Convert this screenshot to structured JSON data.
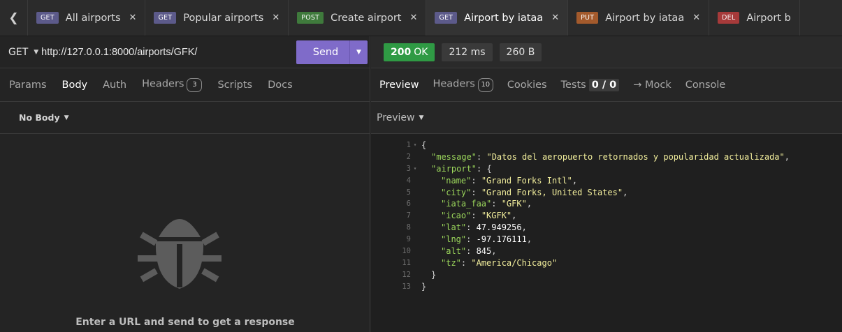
{
  "tabs": [
    {
      "method": "GET",
      "title": "All airports",
      "color": "#5c5a8a",
      "active": false
    },
    {
      "method": "GET",
      "title": "Popular airports",
      "color": "#5c5a8a",
      "active": false
    },
    {
      "method": "POST",
      "title": "Create airport",
      "color": "#3f7a3c",
      "active": false
    },
    {
      "method": "GET",
      "title": "Airport by iataa",
      "color": "#5c5a8a",
      "active": true
    },
    {
      "method": "PUT",
      "title": "Airport by iataa",
      "color": "#a35a2c",
      "active": false
    },
    {
      "method": "DEL",
      "title": "Airport b",
      "color": "#a63a3a",
      "active": false
    }
  ],
  "request": {
    "method": "GET",
    "url": "http://127.0.0.1:8000/airports/GFK/",
    "send_label": "Send",
    "tabs": [
      {
        "label": "Params",
        "active": false
      },
      {
        "label": "Body",
        "active": true
      },
      {
        "label": "Auth",
        "active": false
      },
      {
        "label": "Headers",
        "active": false,
        "count": "3"
      },
      {
        "label": "Scripts",
        "active": false
      },
      {
        "label": "Docs",
        "active": false
      }
    ],
    "body_type": "No Body",
    "empty_message": "Enter a URL and send to get a response"
  },
  "response": {
    "status_code": "200",
    "status_text": "OK",
    "time": "212 ms",
    "size": "260 B",
    "tabs": {
      "preview": "Preview",
      "headers": "Headers",
      "headers_count": "10",
      "cookies": "Cookies",
      "tests": "Tests",
      "tests_count": "0 / 0",
      "mock": "→ Mock",
      "console": "Console"
    },
    "preview_mode": "Preview",
    "lines": [
      {
        "n": "1",
        "fold": "▾",
        "indent": 0,
        "parts": [
          [
            "p",
            "{"
          ]
        ]
      },
      {
        "n": "2",
        "fold": "",
        "indent": 1,
        "parts": [
          [
            "k",
            "\"message\""
          ],
          [
            "p",
            ": "
          ],
          [
            "s",
            "\"Datos del aeropuerto retornados y popularidad actualizada\""
          ],
          [
            "p",
            ","
          ]
        ]
      },
      {
        "n": "3",
        "fold": "▾",
        "indent": 1,
        "parts": [
          [
            "k",
            "\"airport\""
          ],
          [
            "p",
            ": {"
          ]
        ]
      },
      {
        "n": "4",
        "fold": "",
        "indent": 2,
        "parts": [
          [
            "k",
            "\"name\""
          ],
          [
            "p",
            ": "
          ],
          [
            "s",
            "\"Grand Forks Intl\""
          ],
          [
            "p",
            ","
          ]
        ]
      },
      {
        "n": "5",
        "fold": "",
        "indent": 2,
        "parts": [
          [
            "k",
            "\"city\""
          ],
          [
            "p",
            ": "
          ],
          [
            "s",
            "\"Grand Forks, United States\""
          ],
          [
            "p",
            ","
          ]
        ]
      },
      {
        "n": "6",
        "fold": "",
        "indent": 2,
        "parts": [
          [
            "k",
            "\"iata_faa\""
          ],
          [
            "p",
            ": "
          ],
          [
            "s",
            "\"GFK\""
          ],
          [
            "p",
            ","
          ]
        ]
      },
      {
        "n": "7",
        "fold": "",
        "indent": 2,
        "parts": [
          [
            "k",
            "\"icao\""
          ],
          [
            "p",
            ": "
          ],
          [
            "s",
            "\"KGFK\""
          ],
          [
            "p",
            ","
          ]
        ]
      },
      {
        "n": "8",
        "fold": "",
        "indent": 2,
        "parts": [
          [
            "k",
            "\"lat\""
          ],
          [
            "p",
            ": "
          ],
          [
            "n",
            "47.949256"
          ],
          [
            "p",
            ","
          ]
        ]
      },
      {
        "n": "9",
        "fold": "",
        "indent": 2,
        "parts": [
          [
            "k",
            "\"lng\""
          ],
          [
            "p",
            ": "
          ],
          [
            "n",
            "-97.176111"
          ],
          [
            "p",
            ","
          ]
        ]
      },
      {
        "n": "10",
        "fold": "",
        "indent": 2,
        "parts": [
          [
            "k",
            "\"alt\""
          ],
          [
            "p",
            ": "
          ],
          [
            "n",
            "845"
          ],
          [
            "p",
            ","
          ]
        ]
      },
      {
        "n": "11",
        "fold": "",
        "indent": 2,
        "parts": [
          [
            "k",
            "\"tz\""
          ],
          [
            "p",
            ": "
          ],
          [
            "s",
            "\"America/Chicago\""
          ]
        ]
      },
      {
        "n": "12",
        "fold": "",
        "indent": 1,
        "parts": [
          [
            "p",
            "}"
          ]
        ]
      },
      {
        "n": "13",
        "fold": "",
        "indent": 0,
        "parts": [
          [
            "p",
            "}"
          ]
        ]
      }
    ]
  },
  "icons": {
    "back": "chevron-left-icon",
    "bug": "bug-icon"
  }
}
